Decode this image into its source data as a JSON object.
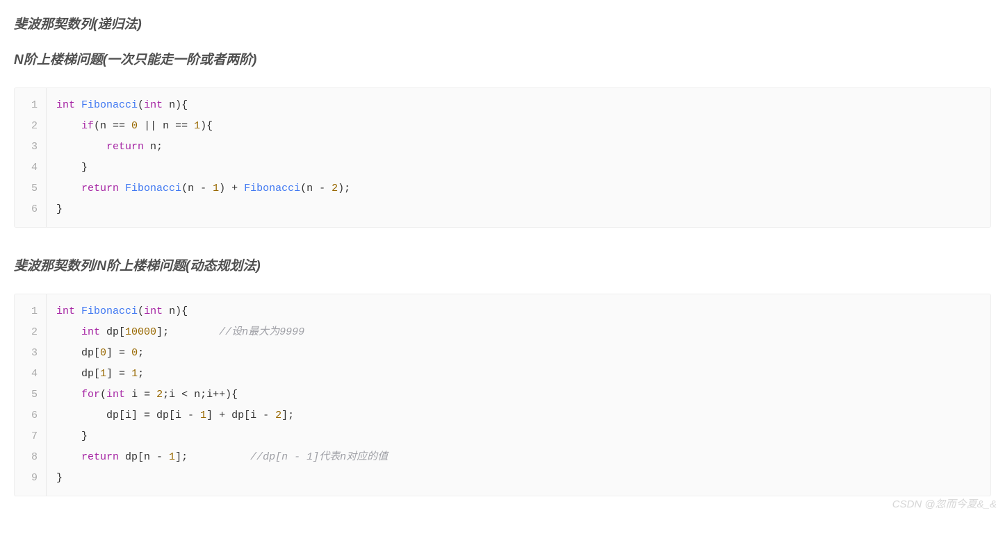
{
  "headings": {
    "h1": "斐波那契数列(递归法)",
    "h2": "N阶上楼梯问题(一次只能走一阶或者两阶)",
    "h3": "斐波那契数列/N阶上楼梯问题(动态规划法)"
  },
  "code1": {
    "line_numbers": [
      "1",
      "2",
      "3",
      "4",
      "5",
      "6"
    ],
    "lines": {
      "l1": {
        "t_int": "int",
        "fn": "Fibonacci",
        "t_int2": "int",
        "var": "n",
        "brace": "){"
      },
      "l2": {
        "kw": "if",
        "cond_open": "(n == ",
        "zero": "0",
        "mid": " || n == ",
        "one": "1",
        "close": "){"
      },
      "l3": {
        "kw": "return",
        "var": " n;"
      },
      "l4": {
        "brace": "}"
      },
      "l5": {
        "kw": "return",
        "fn1": "Fibonacci",
        "arg1_open": "(n - ",
        "one": "1",
        "arg1_close": ") + ",
        "fn2": "Fibonacci",
        "arg2_open": "(n - ",
        "two": "2",
        "arg2_close": ");"
      },
      "l6": {
        "brace": "}"
      }
    }
  },
  "code2": {
    "line_numbers": [
      "1",
      "2",
      "3",
      "4",
      "5",
      "6",
      "7",
      "8",
      "9"
    ],
    "lines": {
      "l1": {
        "t_int": "int",
        "fn": "Fibonacci",
        "t_int2": "int",
        "var": "n",
        "brace": "){"
      },
      "l2": {
        "t_int": "int",
        "arr": " dp[",
        "num": "10000",
        "close": "];",
        "comment": "//设n最大为9999"
      },
      "l3": {
        "pre": "dp[",
        "idx": "0",
        "mid": "] = ",
        "val": "0",
        "end": ";"
      },
      "l4": {
        "pre": "dp[",
        "idx": "1",
        "mid": "] = ",
        "val": "1",
        "end": ";"
      },
      "l5": {
        "kw": "for",
        "open": "(",
        "t_int": "int",
        "init": " i = ",
        "two": "2",
        "cond": ";i < n;i++){"
      },
      "l6": {
        "body": "dp[i] = dp[i - ",
        "one": "1",
        "mid": "] + dp[i - ",
        "two": "2",
        "end": "];"
      },
      "l7": {
        "brace": "}"
      },
      "l8": {
        "kw": "return",
        "expr": " dp[n - ",
        "one": "1",
        "end": "];",
        "comment": "//dp[n - 1]代表n对应的值"
      },
      "l9": {
        "brace": "}"
      }
    }
  },
  "watermark": "CSDN @忽而今夏&_&"
}
